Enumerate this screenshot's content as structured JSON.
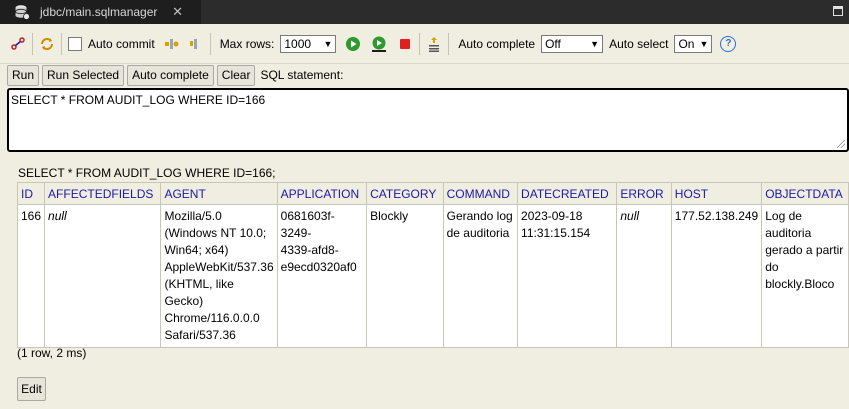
{
  "tab": {
    "title": "jdbc/main.sqlmanager",
    "close": "✕"
  },
  "toolbar": {
    "auto_commit_label": "Auto commit",
    "max_rows_label": "Max rows:",
    "max_rows_value": "1000",
    "auto_complete_label": "Auto complete",
    "auto_complete_value": "Off",
    "auto_select_label": "Auto select",
    "auto_select_value": "On",
    "help": "?",
    "colors": {
      "run": "#2e9a2e",
      "stop": "#e02020",
      "help": "#2b6fd1"
    }
  },
  "buttons": {
    "run": "Run",
    "run_selected": "Run Selected",
    "auto_complete": "Auto complete",
    "clear": "Clear",
    "statement_label": "SQL statement:"
  },
  "sql": {
    "text": "SELECT * FROM AUDIT_LOG WHERE ID=166"
  },
  "results": {
    "title": "SELECT * FROM AUDIT_LOG WHERE ID=166;",
    "columns": [
      "ID",
      "AFFECTEDFIELDS",
      "AGENT",
      "APPLICATION",
      "CATEGORY",
      "COMMAND",
      "DATECREATED",
      "ERROR",
      "HOST",
      "OBJECTDATA"
    ],
    "row": {
      "id": "166",
      "affectedfields": "null",
      "agent_lines": [
        "Mozilla/5.0",
        "(Windows NT 10.0;",
        "Win64; x64)",
        "AppleWebKit/537.36",
        "(KHTML, like",
        "Gecko)",
        "Chrome/116.0.0.0",
        "Safari/537.36"
      ],
      "application_lines": [
        "0681603f-3249-",
        "4339-afd8-",
        "e9ecd0320af0"
      ],
      "category": "Blockly",
      "command_lines": [
        "Gerando log",
        "de auditoria"
      ],
      "datecreated_lines": [
        "2023-09-18",
        "11:31:15.154"
      ],
      "error": "null",
      "host": "177.52.138.249",
      "objectdata_lines": [
        "Log de",
        "auditoria",
        "gerado a partir",
        "do",
        "blockly.Bloco"
      ]
    },
    "count": "(1 row, 2 ms)",
    "edit": "Edit"
  }
}
